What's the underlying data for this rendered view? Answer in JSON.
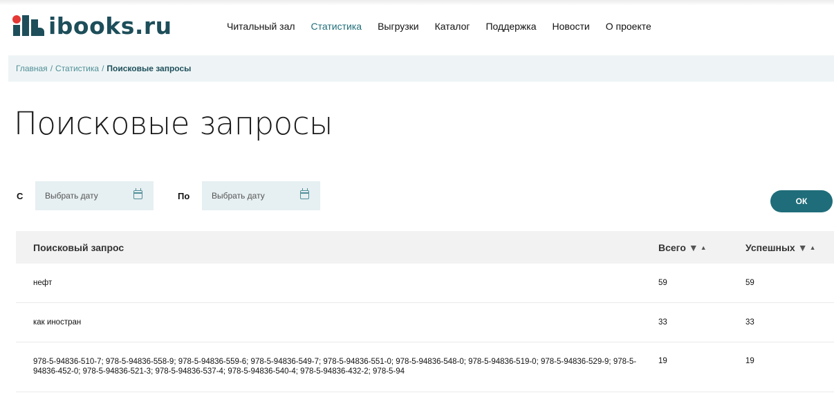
{
  "brand": {
    "logo_text": "ibooks.ru",
    "colors": {
      "primary": "#1d4e5a",
      "accent": "#1f6d7a",
      "dot": "#e53935"
    }
  },
  "nav": {
    "items": [
      {
        "label": "Читальный зал",
        "active": false
      },
      {
        "label": "Статистика",
        "active": true
      },
      {
        "label": "Выгрузки",
        "active": false
      },
      {
        "label": "Каталог",
        "active": false
      },
      {
        "label": "Поддержка",
        "active": false
      },
      {
        "label": "Новости",
        "active": false
      },
      {
        "label": "О проекте",
        "active": false
      }
    ]
  },
  "breadcrumb": {
    "home": "Главная",
    "section": "Статистика",
    "current": "Поисковые запросы",
    "separator": "/"
  },
  "page": {
    "title": "Поисковые запросы"
  },
  "filter": {
    "from_label": "С",
    "to_label": "По",
    "from_placeholder": "Выбрать дату",
    "to_placeholder": "Выбрать дату",
    "ok_label": "ОК"
  },
  "table": {
    "columns": {
      "query": "Поисковый запрос",
      "total": "Всего",
      "success": "Успешных"
    },
    "sort_down": "▼",
    "sort_up": "▲",
    "rows": [
      {
        "query": "нефт",
        "total": "59",
        "success": "59"
      },
      {
        "query": "как иностран",
        "total": "33",
        "success": "33"
      },
      {
        "query": "978-5-94836-510-7; 978-5-94836-558-9; 978-5-94836-559-6; 978-5-94836-549-7; 978-5-94836-551-0; 978-5-94836-548-0; 978-5-94836-519-0; 978-5-94836-529-9; 978-5-94836-452-0; 978-5-94836-521-3; 978-5-94836-537-4; 978-5-94836-540-4; 978-5-94836-432-2; 978-5-94",
        "total": "19",
        "success": "19"
      }
    ]
  }
}
